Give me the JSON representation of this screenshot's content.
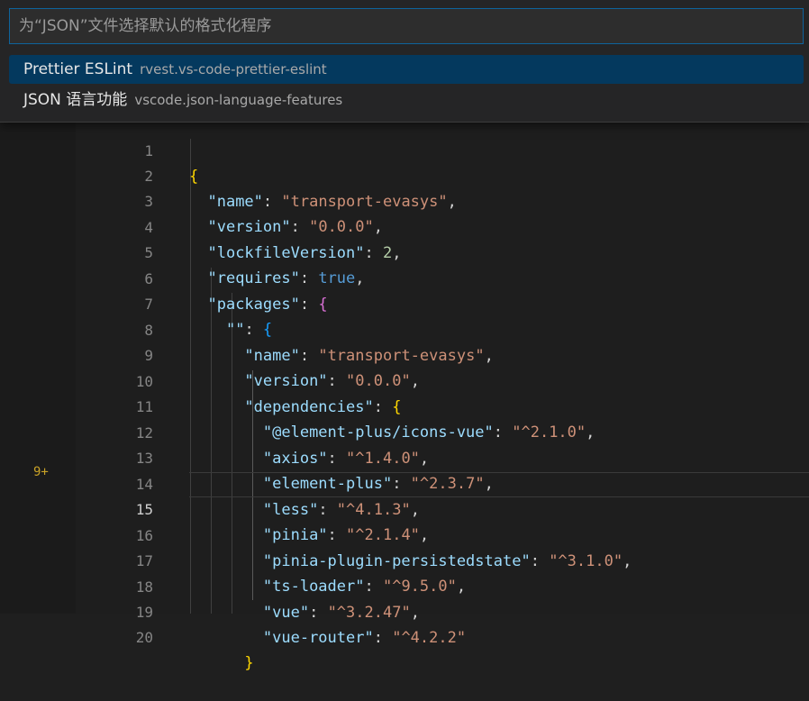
{
  "quick_pick": {
    "placeholder": "为“JSON”文件选择默认的格式化程序",
    "items": [
      {
        "label": "Prettier ESLint",
        "description": "rvest.vs-code-prettier-eslint",
        "selected": true
      },
      {
        "label": "JSON 语言功能",
        "description": "vscode.json-language-features",
        "selected": false
      }
    ]
  },
  "gutter": {
    "problems_badge": "9+"
  },
  "editor": {
    "active_line": 15,
    "lines": [
      {
        "n": "1"
      },
      {
        "n": "2"
      },
      {
        "n": "3"
      },
      {
        "n": "4"
      },
      {
        "n": "5"
      },
      {
        "n": "6"
      },
      {
        "n": "7"
      },
      {
        "n": "8"
      },
      {
        "n": "9"
      },
      {
        "n": "10"
      },
      {
        "n": "11"
      },
      {
        "n": "12"
      },
      {
        "n": "13"
      },
      {
        "n": "14"
      },
      {
        "n": "15"
      },
      {
        "n": "16"
      },
      {
        "n": "17"
      },
      {
        "n": "18"
      },
      {
        "n": "19"
      },
      {
        "n": "20"
      }
    ],
    "tokens": {
      "l1_brace": "{",
      "l2_key": "\"name\"",
      "l2_val": "\"transport-evasys\"",
      "l3_key": "\"version\"",
      "l3_val": "\"0.0.0\"",
      "l4_key": "\"lockfileVersion\"",
      "l4_val": "2",
      "l5_key": "\"requires\"",
      "l5_val": "true",
      "l6_key": "\"packages\"",
      "l6_brace": "{",
      "l7_key": "\"\"",
      "l7_brace": "{",
      "l8_key": "\"name\"",
      "l8_val": "\"transport-evasys\"",
      "l9_key": "\"version\"",
      "l9_val": "\"0.0.0\"",
      "l10_key": "\"dependencies\"",
      "l10_brace": "{",
      "l11_key": "\"@element-plus/icons-vue\"",
      "l11_val": "\"^2.1.0\"",
      "l12_key": "\"axios\"",
      "l12_val": "\"^1.4.0\"",
      "l13_key": "\"element-plus\"",
      "l13_val": "\"^2.3.7\"",
      "l14_key": "\"less\"",
      "l14_val": "\"^4.1.3\"",
      "l15_key": "\"pinia\"",
      "l15_val": "\"^2.1.4\"",
      "l16_key": "\"pinia-plugin-persistedstate\"",
      "l16_val": "\"^3.1.0\"",
      "l17_key": "\"ts-loader\"",
      "l17_val": "\"^9.5.0\"",
      "l18_key": "\"vue\"",
      "l18_val": "\"^3.2.47\"",
      "l19_key": "\"vue-router\"",
      "l19_val": "\"^4.2.2\"",
      "l20_brace": "}",
      "colon": ": ",
      "comma": ","
    }
  }
}
